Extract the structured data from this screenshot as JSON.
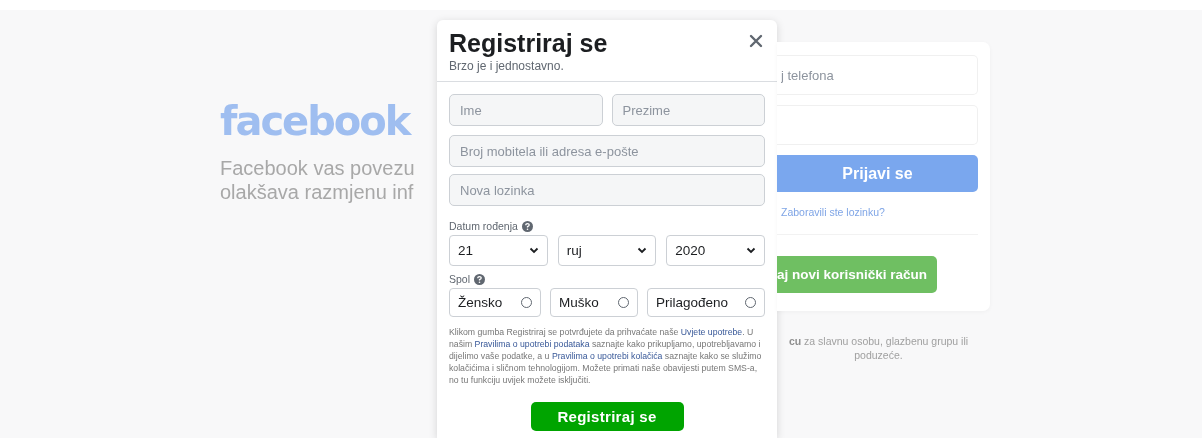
{
  "background": {
    "logo": "facebook",
    "tagline": [
      "Facebook vas povezu",
      "olakšava razmjenu inf"
    ],
    "login": {
      "phone_placeholder": "j telefona",
      "login_button": "Prijavi se",
      "forgot_link": "Zaboravili ste lozinku?",
      "create_button": "aj novi korisnički račun",
      "page_note": "**cu** za slavnu osobu, glazbenu grupu ili poduzeće."
    }
  },
  "dialog": {
    "title": "Registriraj se",
    "subtitle": "Brzo je i jednostavno.",
    "fields": [
      {
        "placeholder": "Ime"
      },
      {
        "placeholder": "Prezime"
      },
      {
        "placeholder": "Broj mobitela ili adresa e-pošte"
      },
      {
        "placeholder": "Nova lozinka"
      }
    ],
    "birthday": {
      "label": "Datum rođenja",
      "day": "21",
      "month": "ruj",
      "year": "2020"
    },
    "gender": {
      "label": "Spol",
      "options": [
        {
          "label": "Žensko",
          "selected": false
        },
        {
          "label": "Muško",
          "selected": false
        },
        {
          "label": "Prilagođeno",
          "selected": false
        }
      ]
    },
    "legal": [
      {
        "kind": "text",
        "text": "Klikom gumba Registriraj se potvrđujete da prihvaćate naše "
      },
      {
        "kind": "link",
        "text": "Uvjete upotrebe"
      },
      {
        "kind": "text",
        "text": ". U našim "
      },
      {
        "kind": "link",
        "text": "Pravilima o upotrebi podataka"
      },
      {
        "kind": "text",
        "text": " saznajte kako prikupljamo, upotrebljavamo i dijelimo vaše podatke, a u "
      },
      {
        "kind": "link",
        "text": "Pravilima o upotrebi kolačića"
      },
      {
        "kind": "text",
        "text": " saznajte kako se služimo kolačićima i sličnom tehnologijom. Možete primati naše obavijesti putem SMS-a, no tu funkciju uvijek možete isključiti."
      }
    ],
    "submit": "Registriraj se"
  }
}
